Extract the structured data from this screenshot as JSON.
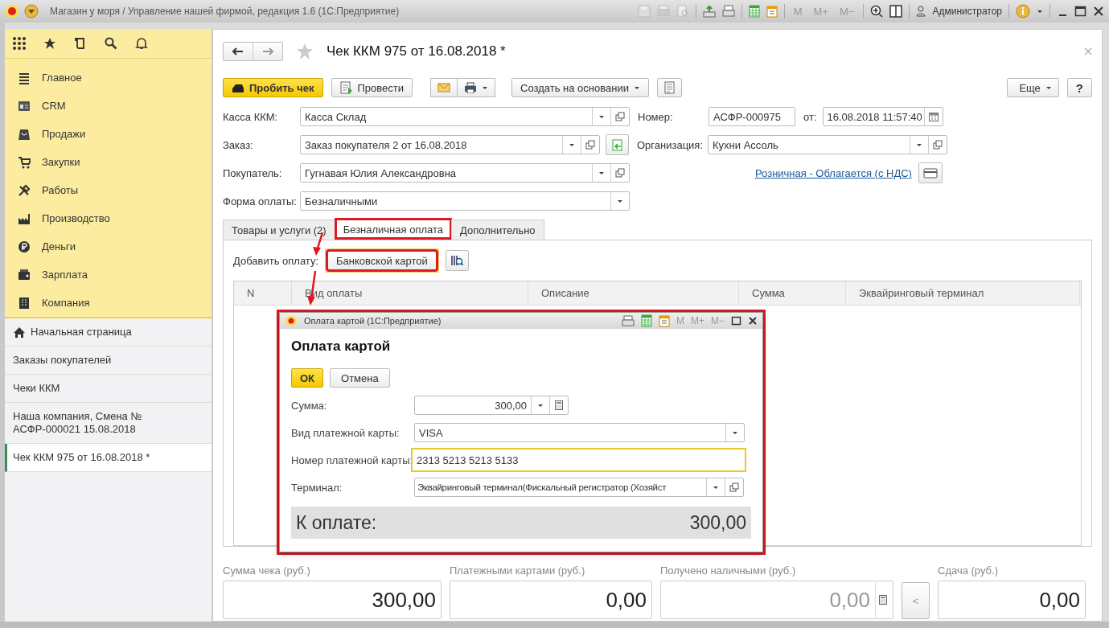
{
  "window": {
    "title": "Магазин у моря / Управление нашей фирмой, редакция 1.6  (1С:Предприятие)",
    "memory_buttons": [
      "M",
      "M+",
      "M−"
    ],
    "user": "Администратор"
  },
  "sidebar": {
    "sections": [
      {
        "label": "Главное"
      },
      {
        "label": "CRM"
      },
      {
        "label": "Продажи"
      },
      {
        "label": "Закупки"
      },
      {
        "label": "Работы"
      },
      {
        "label": "Производство"
      },
      {
        "label": "Деньги"
      },
      {
        "label": "Зарплата"
      },
      {
        "label": "Компания"
      }
    ],
    "open_pages": [
      {
        "label": "Начальная страница",
        "kind": "home",
        "selected": false
      },
      {
        "label": "Заказы покупателей",
        "kind": "page",
        "selected": false
      },
      {
        "label": "Чеки ККМ",
        "kind": "page",
        "selected": false
      },
      {
        "label": "Наша компания, Смена № АСФР-000021  15.08.2018",
        "kind": "page",
        "selected": false
      },
      {
        "label": "Чек ККМ 975 от 16.08.2018 *",
        "kind": "page",
        "selected": true
      }
    ]
  },
  "document": {
    "title": "Чек ККМ 975 от 16.08.2018 *",
    "favorite": false,
    "toolbar": {
      "primary": "Пробить чек",
      "post": "Провести",
      "create_based_on": "Создать на основании",
      "more": "Еще",
      "help": "?"
    },
    "fields": {
      "cash_register": {
        "label": "Касса ККМ:",
        "value": "Касса Склад"
      },
      "order": {
        "label": "Заказ:",
        "value": "Заказ покупателя 2 от 16.08.2018"
      },
      "customer": {
        "label": "Покупатель:",
        "value": "Гугнавая Юлия Александровна"
      },
      "payment_form": {
        "label": "Форма оплаты:",
        "value": "Безналичными"
      },
      "number": {
        "label": "Номер:",
        "value": "АСФР-000975"
      },
      "date": {
        "label": "от:",
        "value": "16.08.2018 11:57:40"
      },
      "organization": {
        "label": "Организация:",
        "value": "Кухни Ассоль"
      },
      "tax_link": "Розничная - Облагается (с НДС)"
    },
    "tabs": [
      {
        "label": "Товары и услуги (2)",
        "selected": false,
        "highlighted": false
      },
      {
        "label": "Безналичная оплата",
        "selected": true,
        "highlighted": true
      },
      {
        "label": "Дополнительно",
        "selected": false,
        "highlighted": false
      }
    ],
    "add_payment": {
      "label": "Добавить оплату:",
      "button": "Банковской картой",
      "highlighted": true
    },
    "table": {
      "columns": [
        "N",
        "Вид оплаты",
        "Описание",
        "Сумма",
        "Эквайринговый терминал"
      ]
    },
    "totals": [
      {
        "kind": "field",
        "label": "Сумма чека (руб.)",
        "value": "300,00",
        "disabled": false
      },
      {
        "kind": "field",
        "label": "Платежными картами (руб.)",
        "value": "0,00",
        "disabled": false
      },
      {
        "kind": "calc",
        "label": "Получено наличными (руб.)",
        "value": "0,00",
        "disabled": true
      },
      {
        "kind": "button",
        "text": "<"
      },
      {
        "kind": "field",
        "label": "Сдача (руб.)",
        "value": "0,00",
        "disabled": false
      }
    ]
  },
  "dialog": {
    "title": "Оплата картой  (1С:Предприятие)",
    "memory_buttons": [
      "M",
      "M+",
      "M−"
    ],
    "heading": "Оплата картой",
    "highlighted": true,
    "buttons": {
      "ok": "ОК",
      "cancel": "Отмена"
    },
    "fields": [
      {
        "kind": "amount",
        "label": "Сумма:",
        "value": "300,00",
        "focused": false
      },
      {
        "kind": "select",
        "label": "Вид платежной карты:",
        "value": "VISA",
        "focused": false
      },
      {
        "kind": "text",
        "label": "Номер платежной карты:",
        "value": "2313 5213 5213 5133",
        "focused": true
      },
      {
        "kind": "ref",
        "label": "Терминал:",
        "value": "Эквайринговый терминал(Фискальный регистратор (Хозяйст",
        "focused": false
      }
    ],
    "total": {
      "label": "К оплате:",
      "value": "300,00"
    }
  }
}
